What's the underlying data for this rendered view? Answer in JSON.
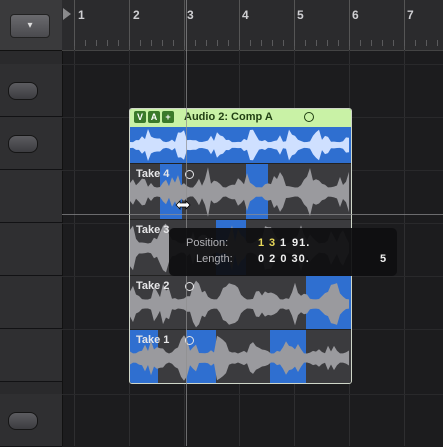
{
  "sidebar": {
    "top_button_icon": "dropdown-icon"
  },
  "ruler": {
    "bars": [
      "1",
      "2",
      "3",
      "4",
      "5",
      "6",
      "7"
    ]
  },
  "comp": {
    "icons": [
      "V",
      "A",
      "+"
    ],
    "title": "Audio 2: Comp A"
  },
  "takes": [
    {
      "label": "Take 4"
    },
    {
      "label": "Take 3"
    },
    {
      "label": "Take 2"
    },
    {
      "label": "Take 1"
    }
  ],
  "tooltip": {
    "position_label": "Position:",
    "position_value_part1": "1",
    "position_value_part2": "3",
    "position_value_part3": "1",
    "position_value_part4": "91.",
    "length_label": "Length:",
    "length_value": "0 2 0 30.",
    "extra_value": "5"
  },
  "colors": {
    "accent_blue": "#2f6fd0",
    "comp_header": "#c9f2a6",
    "highlight_yellow": "#e8d85a"
  }
}
